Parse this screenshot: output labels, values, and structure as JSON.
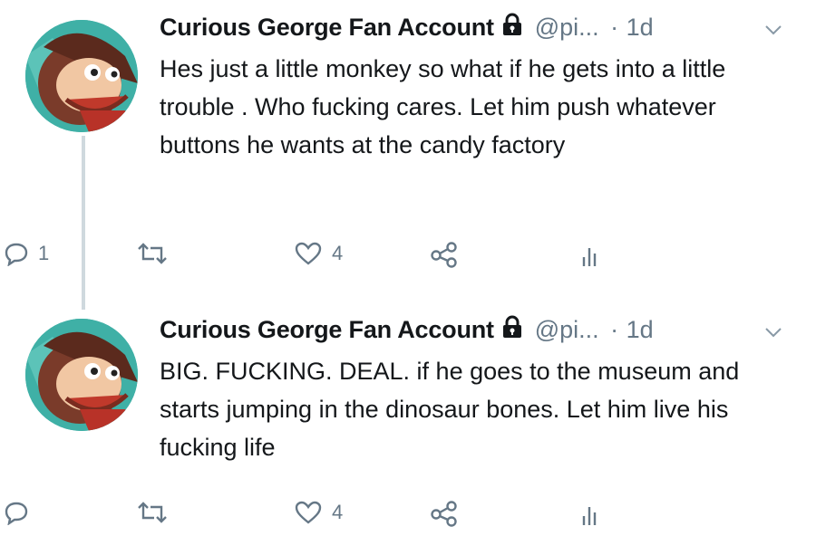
{
  "tweets": [
    {
      "display_name": "Curious George Fan Account",
      "handle": "@pi...",
      "separator": "·",
      "time": "1d",
      "text": "Hes just a little monkey so what if he gets into a little trouble . Who fucking cares. Let him push whatever buttons he wants at the candy factory",
      "reply_count": "1",
      "like_count": "4"
    },
    {
      "display_name": "Curious George Fan Account",
      "handle": "@pi...",
      "separator": "·",
      "time": "1d",
      "text": "BIG. FUCKING. DEAL. if he goes to the museum and starts jumping in the dinosaur bones. Let him live his fucking life",
      "reply_count": "",
      "like_count": "4"
    }
  ],
  "icons": {
    "lock": "lock-icon",
    "chevron": "chevron-down-icon",
    "reply": "reply-icon",
    "retweet": "retweet-icon",
    "like": "heart-icon",
    "share": "share-icon",
    "analytics": "analytics-icon"
  },
  "colors": {
    "text": "#14171a",
    "muted": "#657786",
    "thread_line": "#cfd9de",
    "avatar_bg": "#3fb0a6"
  }
}
